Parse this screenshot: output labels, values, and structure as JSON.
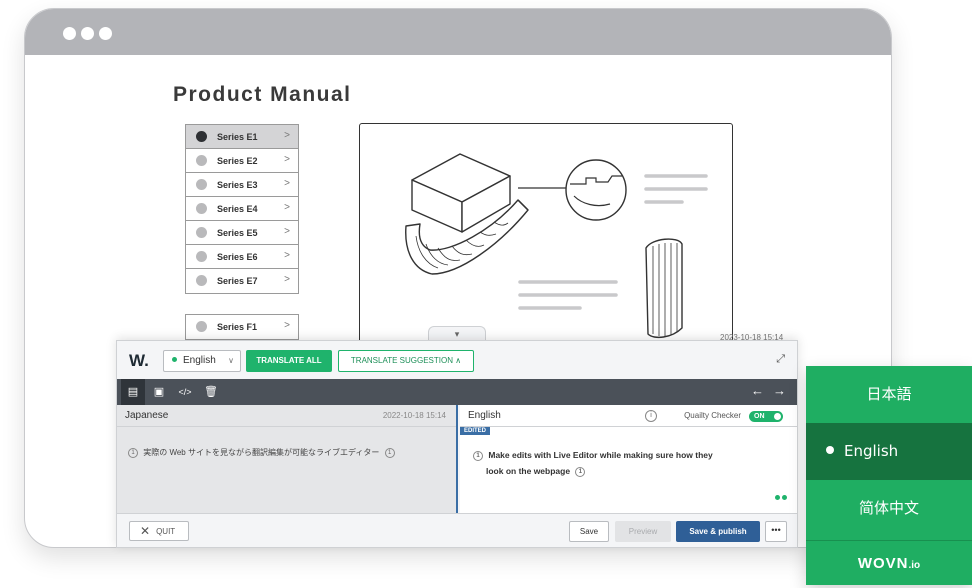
{
  "page": {
    "title": "Product Manual",
    "series_group_e": [
      "Series E1",
      "Series E2",
      "Series E3",
      "Series E4",
      "Series E5",
      "Series E6",
      "Series E7"
    ],
    "series_group_f": [
      "Series F1"
    ],
    "selected_series": "Series E1"
  },
  "editor": {
    "logo": "W.",
    "current_language": "English",
    "translate_all_label": "TRANSLATE ALL",
    "translate_suggestion_label": "TRANSLATE SUGGESTION",
    "timestamp_top": "2023-10-18 15:14",
    "source": {
      "label": "Japanese",
      "timestamp": "2022-10-18 15:14",
      "segment_number": "1",
      "text": "実際の Web サイトを見ながら翻訳編集が可能なライブエディター"
    },
    "target": {
      "label": "English",
      "edited_badge": "EDITED",
      "quality_checker_label": "Quailty Checker",
      "quality_checker_state": "ON",
      "segment_number": "1",
      "text_line1": "Make edits with Live Editor while making sure how they",
      "text_line2": "look on the webpage"
    },
    "footer": {
      "quit_label": "QUIT",
      "save_label": "Save",
      "preview_label": "Preview",
      "publish_label": "Save & publish",
      "more_label": "•••"
    },
    "colors": {
      "accent_green": "#1fb36c",
      "publish_blue": "#2f5f97",
      "toolbar": "#4b5159"
    }
  },
  "switcher": {
    "languages": [
      "日本語",
      "English",
      "简体中文"
    ],
    "active": "English",
    "brand": "WOVN",
    "brand_suffix": ".io"
  }
}
